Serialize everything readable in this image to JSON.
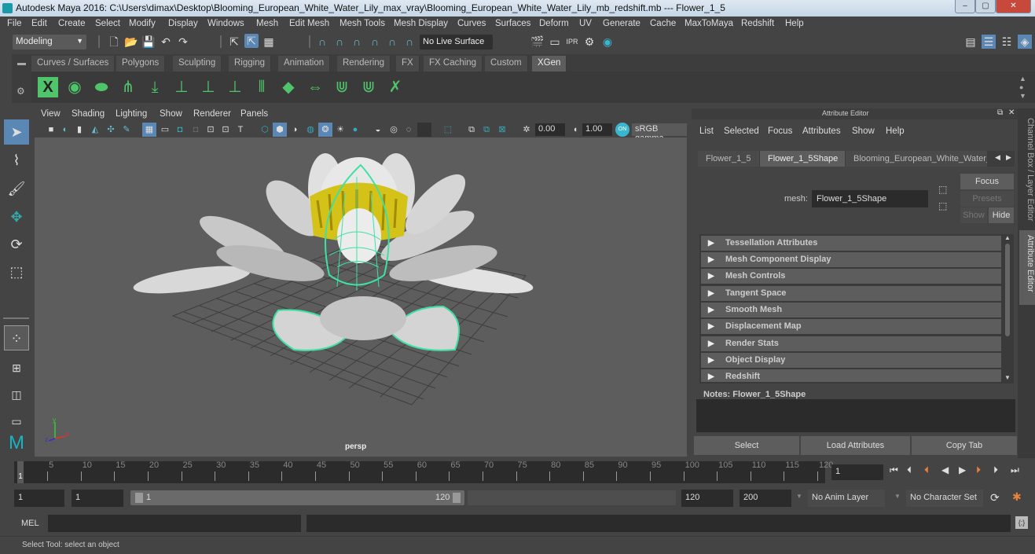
{
  "window": {
    "title": "Autodesk Maya 2016: C:\\Users\\dimax\\Desktop\\Blooming_European_White_Water_Lily_max_vray\\Blooming_European_White_Water_Lily_mb_redshift.mb  ---  Flower_1_5",
    "minimize": "–",
    "maximize": "▢",
    "close": "✕"
  },
  "menubar": [
    "File",
    "Edit",
    "Create",
    "Select",
    "Modify",
    "Display",
    "Windows",
    "Mesh",
    "Edit Mesh",
    "Mesh Tools",
    "Mesh Display",
    "Curves",
    "Surfaces",
    "Deform",
    "UV",
    "Generate",
    "Cache",
    "MaxToMaya",
    "Redshift",
    "Help"
  ],
  "statusline": {
    "menuset": "Modeling",
    "live_surface": "No Live Surface"
  },
  "shelf": {
    "tabs": [
      "Curves / Surfaces",
      "Polygons",
      "Sculpting",
      "Rigging",
      "Animation",
      "Rendering",
      "FX",
      "FX Caching",
      "Custom",
      "XGen"
    ],
    "active_tab": "XGen"
  },
  "viewport": {
    "menu": [
      "View",
      "Shading",
      "Lighting",
      "Show",
      "Renderer",
      "Panels"
    ],
    "exposure": "0.00",
    "gamma": "1.00",
    "color_mgmt_toggle": "ON",
    "color_space": "sRGB gamma",
    "camera_label": "persp",
    "axis": {
      "x": "x",
      "y": "y",
      "z": "z"
    }
  },
  "attribute_editor": {
    "title": "Attribute Editor",
    "menu": [
      "List",
      "Selected",
      "Focus",
      "Attributes",
      "Show",
      "Help"
    ],
    "tabs": [
      "Flower_1_5",
      "Flower_1_5Shape",
      "Blooming_European_White_Water_"
    ],
    "active_tab": "Flower_1_5Shape",
    "node_label": "mesh:",
    "node_value": "Flower_1_5Shape",
    "focus_btn": "Focus",
    "presets_btn": "Presets",
    "show_btn": "Show",
    "hide_btn": "Hide",
    "sections": [
      "Tessellation Attributes",
      "Mesh Component Display",
      "Mesh Controls",
      "Tangent Space",
      "Smooth Mesh",
      "Displacement Map",
      "Render Stats",
      "Object Display",
      "Redshift"
    ],
    "notes_label": "Notes:  Flower_1_5Shape",
    "buttons": [
      "Select",
      "Load Attributes",
      "Copy Tab"
    ]
  },
  "side_tabs": [
    "Channel Box / Layer Editor",
    "Attribute Editor"
  ],
  "timeline": {
    "ticks": [
      "5",
      "10",
      "15",
      "20",
      "25",
      "30",
      "35",
      "40",
      "45",
      "50",
      "55",
      "60",
      "65",
      "70",
      "75",
      "80",
      "85",
      "90",
      "95",
      "100",
      "105",
      "110",
      "115",
      "120"
    ],
    "current_frame_marker": "1",
    "current_frame": "1"
  },
  "range": {
    "start": "1",
    "playback_start": "1",
    "slider_start": "1",
    "slider_end": "120",
    "playback_end": "120",
    "end": "200",
    "anim_layer": "No Anim Layer",
    "character_set": "No Character Set"
  },
  "command": {
    "label": "MEL"
  },
  "help_line": "Select Tool: select an object"
}
